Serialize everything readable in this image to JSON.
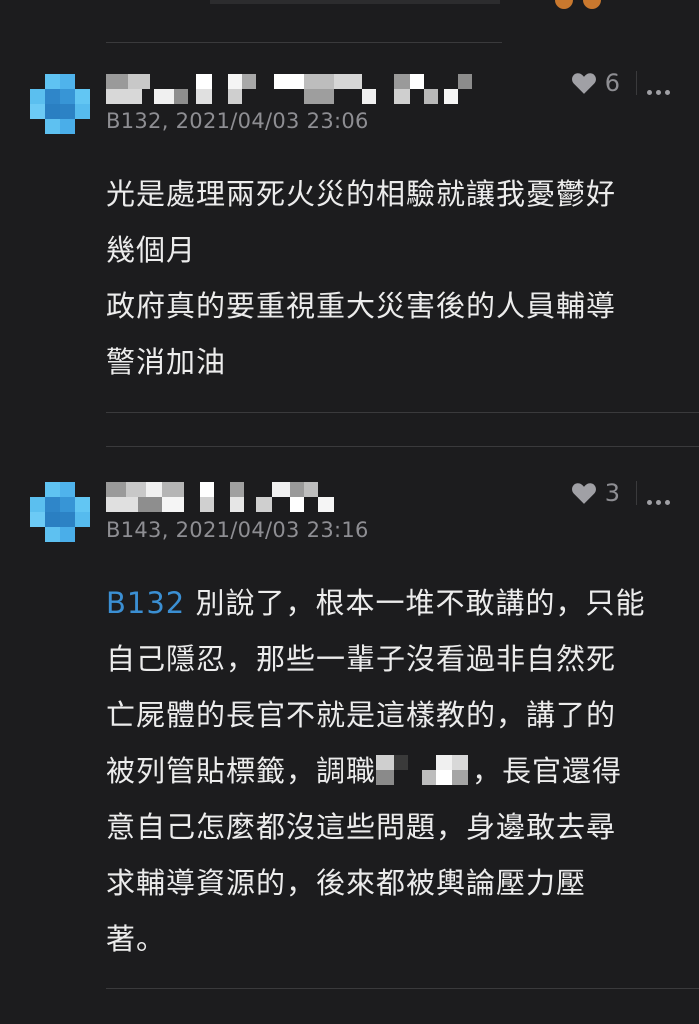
{
  "comments": [
    {
      "floor_time": "B132, 2021/04/03 23:06",
      "like_count": "6",
      "body_lines": [
        "光是處理兩死火災的相驗就讓我憂鬱好",
        "幾個月",
        "政府真的要重視重大災害後的人員輔導",
        "警消加油"
      ]
    },
    {
      "floor_time": "B143, 2021/04/03 23:16",
      "like_count": "3",
      "reply_ref": "B132",
      "body_line1_rest": " 別說了，根本一堆不敢講的，只能",
      "body_lines_mid": [
        "自己隱忍，那些一輩子沒看過非自然死",
        "亡屍體的長官不就是這樣教的，講了的"
      ],
      "body_line4_prefix": "被列管貼標籤，調職",
      "body_line4_suffix": "，長官還得",
      "body_lines_end": [
        "意自己怎麼都沒這些問題，身邊敢去尋",
        "求輔導資源的，後來都被輿論壓力壓",
        "著。"
      ]
    }
  ],
  "icons": {
    "like": "heart-icon",
    "more": "more-options-icon",
    "avatar": "pixelated-avatar"
  },
  "colors": {
    "background": "#1c1c1e",
    "reply_link": "#3b8fd3",
    "meta_text": "#8e8e93",
    "avatar_blue": "#3aa0e0"
  }
}
